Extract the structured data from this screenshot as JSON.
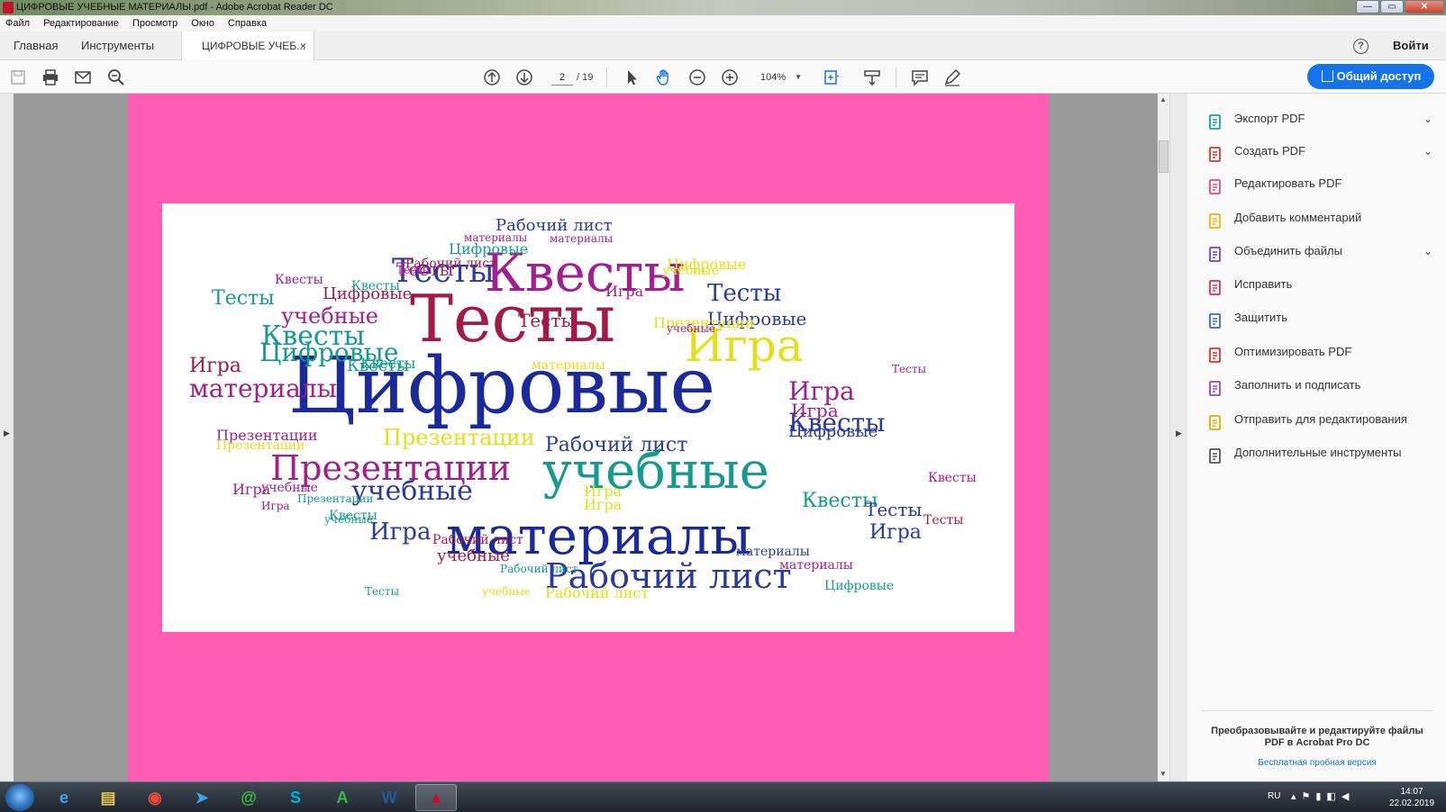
{
  "window": {
    "title": "ЦИФРОВЫЕ УЧЕБНЫЕ МАТЕРИАЛЫ.pdf - Adobe Acrobat Reader DC",
    "minimize": "—",
    "maximize": "▭",
    "close": "✕"
  },
  "menu": {
    "items": [
      "Файл",
      "Редактирование",
      "Просмотр",
      "Окно",
      "Справка"
    ]
  },
  "tabs": {
    "home": "Главная",
    "tools": "Инструменты",
    "document": "ЦИФРОВЫЕ УЧЕБ...",
    "close": "×",
    "help": "?",
    "login": "Войти"
  },
  "toolbar": {
    "page_current": "2",
    "page_total": "/ 19",
    "zoom": "104%",
    "share_label": "Общий доступ",
    "icons": [
      "save-icon",
      "print-icon",
      "mail-icon",
      "search-icon",
      "prev-page-icon",
      "next-page-icon",
      "pointer-icon",
      "hand-icon",
      "zoom-out-icon",
      "zoom-in-icon",
      "fit-page-icon",
      "scroll-mode-icon",
      "comment-icon",
      "pen-icon"
    ]
  },
  "wordcloud": {
    "words": [
      {
        "t": "Цифровые",
        "c": "#1b2a9a"
      },
      {
        "t": "Тесты",
        "c": "#a21a4a"
      },
      {
        "t": "Квесты",
        "c": "#a31e8e"
      },
      {
        "t": "Игра",
        "c": "#e0e01c"
      },
      {
        "t": "учебные",
        "c": "#159b8e"
      },
      {
        "t": "материалы",
        "c": "#1b2a9a"
      },
      {
        "t": "Рабочий лист",
        "c": "#2a3aa0"
      },
      {
        "t": "Презентации",
        "c": "#a31e8e"
      },
      {
        "t": "Квесты",
        "c": "#2a3aa0"
      },
      {
        "t": "материалы",
        "c": "#a31e8e"
      },
      {
        "t": "учебные",
        "c": "#2a3aa0"
      },
      {
        "t": "Игра",
        "c": "#2a3aa0"
      },
      {
        "t": "Презентации",
        "c": "#e0e01c"
      },
      {
        "t": "Рабочий лист",
        "c": "#2a3aa0"
      },
      {
        "t": "Тесты",
        "c": "#2a3aa0"
      },
      {
        "t": "Тесты",
        "c": "#2a3aa0"
      },
      {
        "t": "Квесты",
        "c": "#159b8e"
      },
      {
        "t": "Цифровые",
        "c": "#159b8e"
      },
      {
        "t": "Цифровые",
        "c": "#2a3aa0"
      },
      {
        "t": "учебные",
        "c": "#a31e8e"
      },
      {
        "t": "Игра",
        "c": "#a21a4a"
      },
      {
        "t": "Игра",
        "c": "#a31e8e"
      },
      {
        "t": "Квесты",
        "c": "#159b8e"
      },
      {
        "t": "Тесты",
        "c": "#2a3aa0"
      },
      {
        "t": "Игра",
        "c": "#2a3aa0"
      },
      {
        "t": "Тесты",
        "c": "#159b8e"
      },
      {
        "t": "Тесты",
        "c": "#a21a4a"
      },
      {
        "t": "Тесты",
        "c": "#a31e8e"
      },
      {
        "t": "Игра",
        "c": "#a31e8e"
      },
      {
        "t": "Игра",
        "c": "#a31e8e"
      },
      {
        "t": "Рабочий лист",
        "c": "#2a3aa0"
      },
      {
        "t": "учебные",
        "c": "#a21a4a"
      },
      {
        "t": "материалы",
        "c": "#2a3aa0"
      },
      {
        "t": "Квесты",
        "c": "#159b8e"
      },
      {
        "t": "Цифровые",
        "c": "#159b8e"
      },
      {
        "t": "Цифровые",
        "c": "#a21a4a"
      },
      {
        "t": "Рабочий лист",
        "c": "#a21a4a"
      },
      {
        "t": "Презентации",
        "c": "#e0e01c"
      },
      {
        "t": "Игра",
        "c": "#e0e01c"
      },
      {
        "t": "Игра",
        "c": "#a31e8e"
      },
      {
        "t": "Квесты",
        "c": "#159b8e"
      },
      {
        "t": "Тесты",
        "c": "#a21a4a"
      },
      {
        "t": "Цифровые",
        "c": "#e0e01c"
      },
      {
        "t": "Квесты",
        "c": "#159b8e"
      },
      {
        "t": "Тесты",
        "c": "#a31e8e"
      },
      {
        "t": "учебные",
        "c": "#159b8e"
      },
      {
        "t": "материалы",
        "c": "#a31e8e"
      },
      {
        "t": "Презентации",
        "c": "#a31e8e"
      },
      {
        "t": "Презентации",
        "c": "#e0e01c"
      },
      {
        "t": "учебные",
        "c": "#e0e01c"
      },
      {
        "t": "материалы",
        "c": "#e0e01c"
      },
      {
        "t": "Квесты",
        "c": "#a31e8e"
      },
      {
        "t": "Тесты",
        "c": "#a31e8e"
      },
      {
        "t": "Квесты",
        "c": "#a31e8e"
      },
      {
        "t": "Рабочий лист",
        "c": "#a21a4a"
      },
      {
        "t": "Цифровые",
        "c": "#2a3aa0"
      },
      {
        "t": "учебные",
        "c": "#a31e8e"
      },
      {
        "t": "Презентации",
        "c": "#159b8e"
      },
      {
        "t": "Игра",
        "c": "#e0e01c"
      },
      {
        "t": "материалы",
        "c": "#a31e8e"
      },
      {
        "t": "Рабочий лист",
        "c": "#e0e01c"
      },
      {
        "t": "учебные",
        "c": "#a31e8e"
      },
      {
        "t": "Цифровые",
        "c": "#159b8e"
      },
      {
        "t": "материалы",
        "c": "#a31e8e"
      },
      {
        "t": "Рабочий лист",
        "c": "#159b8e"
      },
      {
        "t": "учебные",
        "c": "#e0e01c"
      },
      {
        "t": "Тесты",
        "c": "#159b8e"
      },
      {
        "t": "Игра",
        "c": "#a31e8e"
      },
      {
        "t": "Квесты",
        "c": "#159b8e"
      }
    ]
  },
  "panel": {
    "tools": [
      {
        "label": "Экспорт PDF",
        "icon": "export-pdf-icon",
        "color": "#16a39b",
        "chevron": true
      },
      {
        "label": "Создать PDF",
        "icon": "create-pdf-icon",
        "color": "#e2322b",
        "chevron": true
      },
      {
        "label": "Редактировать PDF",
        "icon": "edit-pdf-icon",
        "color": "#e34a7a",
        "chevron": false
      },
      {
        "label": "Добавить комментарий",
        "icon": "comment-icon",
        "color": "#f0b400",
        "chevron": false
      },
      {
        "label": "Объединить файлы",
        "icon": "combine-files-icon",
        "color": "#6b45c9",
        "chevron": true
      },
      {
        "label": "Исправить",
        "icon": "fix-icon",
        "color": "#d9315d",
        "chevron": false
      },
      {
        "label": "Защитить",
        "icon": "shield-icon",
        "color": "#3a69c9",
        "chevron": false
      },
      {
        "label": "Оптимизировать PDF",
        "icon": "optimize-pdf-icon",
        "color": "#e2322b",
        "chevron": false
      },
      {
        "label": "Заполнить и подписать",
        "icon": "fill-sign-icon",
        "color": "#7b4fd1",
        "chevron": false
      },
      {
        "label": "Отправить для редактирования",
        "icon": "send-review-icon",
        "color": "#d8b400",
        "chevron": false
      },
      {
        "label": "Дополнительные инструменты",
        "icon": "more-tools-icon",
        "color": "#555555",
        "chevron": false
      }
    ],
    "promo_text": "Преобразовывайте и редактируйте файлы PDF в Acrobat Pro DC",
    "promo_link": "Бесплатная пробная версия"
  },
  "taskbar": {
    "language": "RU",
    "time": "14:07",
    "date": "22.02.2019",
    "apps": [
      {
        "name": "ie",
        "glyph": "e",
        "color": "#3ba0e6"
      },
      {
        "name": "explorer",
        "glyph": "▤",
        "color": "#e6c34a"
      },
      {
        "name": "chrome",
        "glyph": "◉",
        "color": "#e84b3c"
      },
      {
        "name": "telegram",
        "glyph": "➤",
        "color": "#3aa3e0"
      },
      {
        "name": "agent",
        "glyph": "@",
        "color": "#3fbf3f"
      },
      {
        "name": "skype",
        "glyph": "S",
        "color": "#00aff0"
      },
      {
        "name": "app-a",
        "glyph": "A",
        "color": "#39b54a"
      },
      {
        "name": "word",
        "glyph": "W",
        "color": "#2b5797"
      },
      {
        "name": "acrobat",
        "glyph": "▲",
        "color": "#c8102e"
      }
    ]
  }
}
